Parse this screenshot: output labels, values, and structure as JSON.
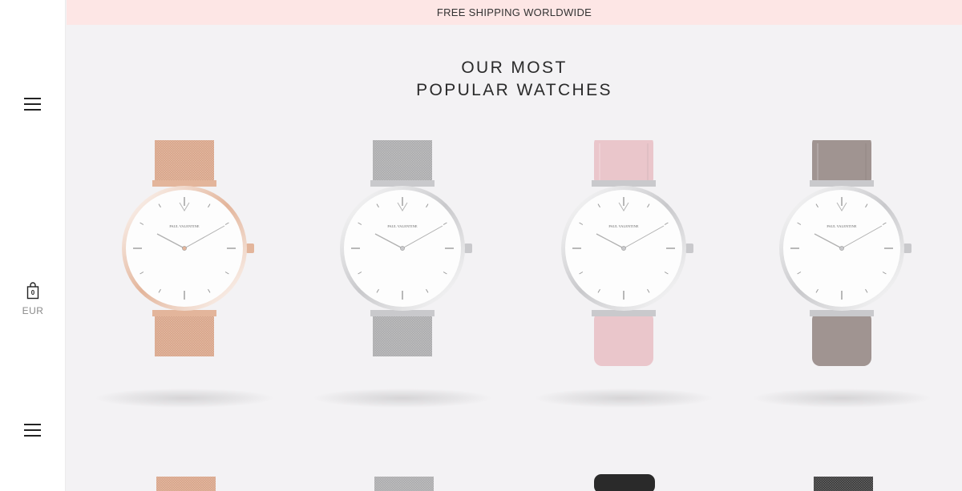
{
  "banner": {
    "text": "FREE SHIPPING WORLDWIDE"
  },
  "heading": {
    "line1": "OUR MOST",
    "line2": "POPULAR WATCHES"
  },
  "sidebar": {
    "menu_icon": "hamburger-menu-icon",
    "cart_icon": "shopping-bag-icon",
    "cart_count": "0",
    "currency": "EUR"
  },
  "products": [
    {
      "strap": "mesh",
      "case": "rose-gold",
      "brand": "PAUL VALENTINE",
      "strap_color": "#d7a184",
      "case_color": "#e3b59b"
    },
    {
      "strap": "mesh",
      "case": "silver",
      "brand": "PAUL VALENTINE",
      "strap_color": "#a8a8aa",
      "case_color": "#c9c9cc"
    },
    {
      "strap": "leather",
      "case": "silver",
      "brand": "PAUL VALENTINE",
      "strap_color": "#eac6cb",
      "case_color": "#c9c9cc"
    },
    {
      "strap": "leather",
      "case": "silver",
      "brand": "PAUL VALENTINE",
      "strap_color": "#a09491",
      "case_color": "#c9c9cc"
    }
  ],
  "next_row_products": [
    {
      "strap": "mesh",
      "strap_color": "#d7a184"
    },
    {
      "strap": "mesh",
      "strap_color": "#a8a8aa"
    },
    {
      "strap": "leather",
      "strap_color": "#2a2a2a"
    },
    {
      "strap": "mesh",
      "strap_color": "#333333"
    }
  ]
}
